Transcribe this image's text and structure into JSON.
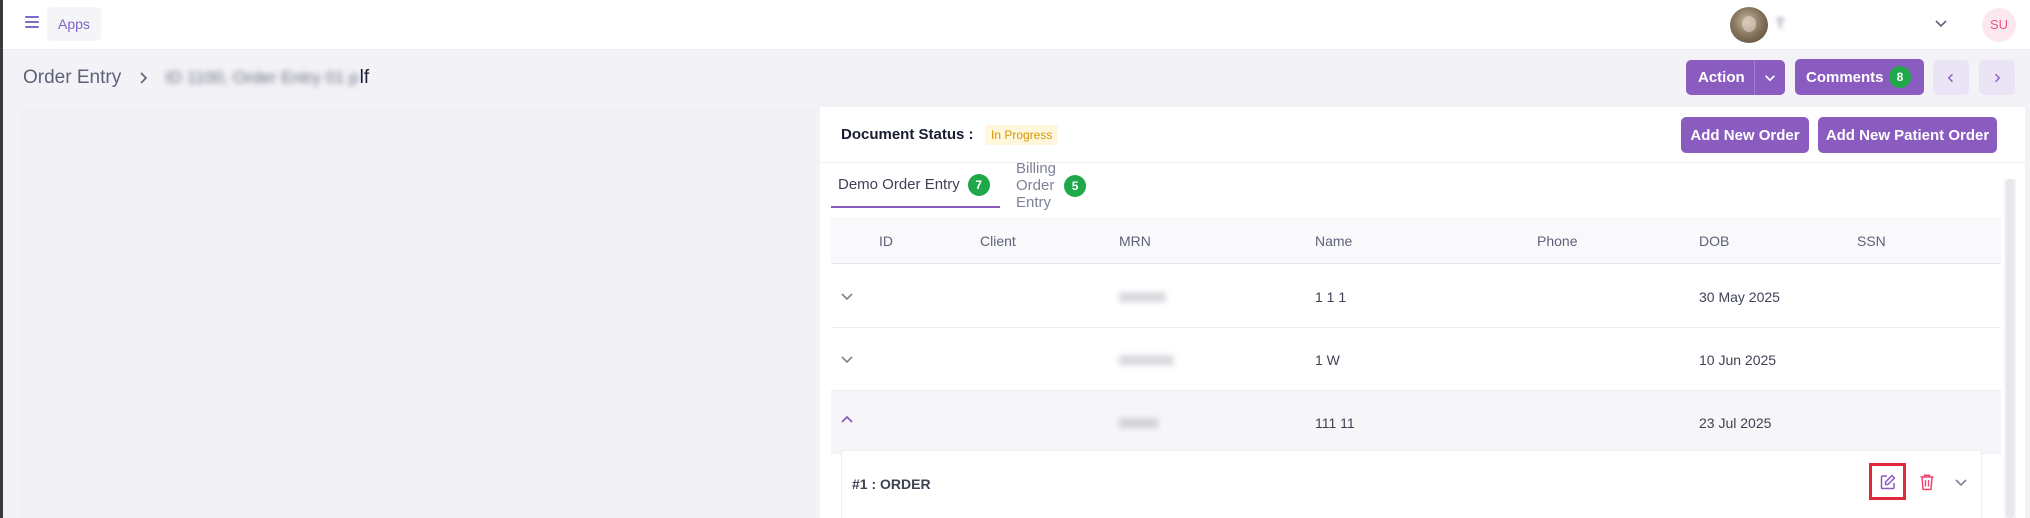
{
  "topbar": {
    "apps_label": "Apps",
    "user_name": "T",
    "user_initials": "SU"
  },
  "breadcrumb": {
    "root": "Order Entry",
    "current_blurred": "ID  1100, Order Entry 01 p",
    "current_tail": "lf"
  },
  "header_actions": {
    "action_label": "Action",
    "comments_label": "Comments",
    "comments_count": "8"
  },
  "document": {
    "status_label": "Document Status :",
    "status_value": "In Progress",
    "add_order_label": "Add New Order",
    "add_patient_order_label": "Add New Patient Order"
  },
  "tabs": [
    {
      "label": "Demo Order Entry",
      "count": "7",
      "active": true
    },
    {
      "label": "Billing Order Entry",
      "count": "5",
      "active": false
    }
  ],
  "table": {
    "columns": [
      "ID",
      "Client",
      "MRN",
      "Name",
      "Phone",
      "DOB",
      "SSN"
    ],
    "rows": [
      {
        "id": "",
        "client": "",
        "mrn": "000000",
        "name": "1 1 1",
        "phone": "",
        "dob": "30 May 2025",
        "ssn": "",
        "expanded": false
      },
      {
        "id": "",
        "client": "",
        "mrn": "0000000",
        "name": "1 W",
        "phone": "",
        "dob": "10 Jun 2025",
        "ssn": "",
        "expanded": false
      },
      {
        "id": "",
        "client": "",
        "mrn": "00000",
        "name": "111 11",
        "phone": "",
        "dob": "23 Jul 2025",
        "ssn": "",
        "expanded": true
      }
    ]
  },
  "order_card": {
    "title": "#1 : ORDER"
  },
  "colors": {
    "primary": "#8a5cc0",
    "badge_green": "#1fa84a",
    "status_warning": "#d49b00",
    "highlight_red": "#e0293a",
    "delete_red": "#f1416c"
  }
}
